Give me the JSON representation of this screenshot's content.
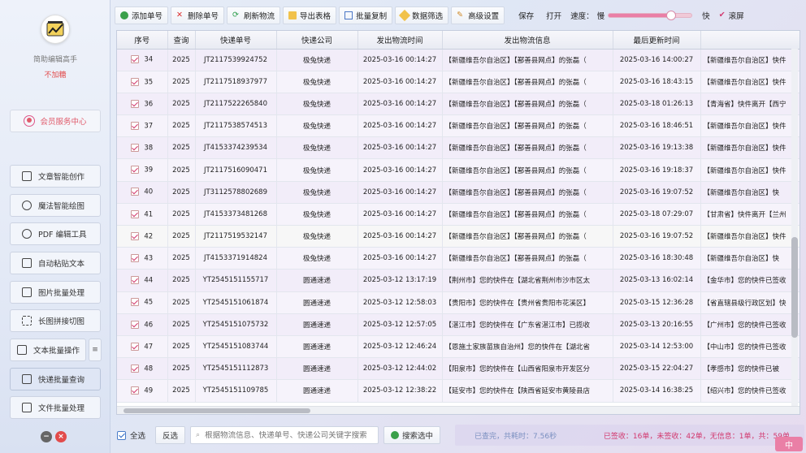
{
  "sidebar": {
    "app_title": "简助编辑高手",
    "app_sub": "不加糖",
    "member_center": "会员服务中心",
    "nav": [
      {
        "label": "文章智能创作",
        "icon": "article-icon"
      },
      {
        "label": "魔法智能绘图",
        "icon": "magic-wand-icon"
      },
      {
        "label": "PDF 编辑工具",
        "icon": "pdf-icon"
      },
      {
        "label": "自动粘贴文本",
        "icon": "paste-icon"
      },
      {
        "label": "图片批量处理",
        "icon": "image-icon"
      },
      {
        "label": "长图拼接切图",
        "icon": "crop-icon"
      },
      {
        "label": "文本批量操作",
        "icon": "text-icon"
      },
      {
        "label": "快递批量查询",
        "icon": "truck-icon"
      },
      {
        "label": "文件批量处理",
        "icon": "file-icon"
      }
    ]
  },
  "toolbar": {
    "add": "添加单号",
    "delete": "删除单号",
    "refresh": "刷新物流",
    "export": "导出表格",
    "copy": "批量复制",
    "filter": "数据筛选",
    "advanced": "高级设置",
    "save": "保存",
    "open": "打开",
    "speed_label": "速度：",
    "slow": "慢",
    "fast": "快",
    "scroll": "滚屏",
    "speed_value": 0.75
  },
  "table": {
    "headers": [
      "序号",
      "查询",
      "快递单号",
      "快递公司",
      "发出物流时间",
      "发出物流信息",
      "最后更新时间",
      ""
    ],
    "rows": [
      {
        "n": "34",
        "q": "2025",
        "no": "JT2117539924752",
        "co": "极兔快递",
        "t1": "2025-03-16 00:14:27",
        "info1": "【新疆维吾尔自治区】【鄯善县网点】的张磊（",
        "t2": "2025-03-16 14:00:27",
        "info2": "【新疆维吾尔自治区】快件"
      },
      {
        "n": "35",
        "q": "2025",
        "no": "JT2117518937977",
        "co": "极兔快递",
        "t1": "2025-03-16 00:14:27",
        "info1": "【新疆维吾尔自治区】【鄯善县网点】的张磊（",
        "t2": "2025-03-16 18:43:15",
        "info2": "【新疆维吾尔自治区】快件"
      },
      {
        "n": "36",
        "q": "2025",
        "no": "JT2117522265840",
        "co": "极兔快递",
        "t1": "2025-03-16 00:14:27",
        "info1": "【新疆维吾尔自治区】【鄯善县网点】的张磊（",
        "t2": "2025-03-18 01:26:13",
        "info2": "【青海省】快件离开【西宁"
      },
      {
        "n": "37",
        "q": "2025",
        "no": "JT2117538574513",
        "co": "极兔快递",
        "t1": "2025-03-16 00:14:27",
        "info1": "【新疆维吾尔自治区】【鄯善县网点】的张磊（",
        "t2": "2025-03-16 18:46:51",
        "info2": "【新疆维吾尔自治区】快件"
      },
      {
        "n": "38",
        "q": "2025",
        "no": "JT4153374239534",
        "co": "极兔快递",
        "t1": "2025-03-16 00:14:27",
        "info1": "【新疆维吾尔自治区】【鄯善县网点】的张磊（",
        "t2": "2025-03-16 19:13:38",
        "info2": "【新疆维吾尔自治区】快件"
      },
      {
        "n": "39",
        "q": "2025",
        "no": "JT2117516090471",
        "co": "极兔快递",
        "t1": "2025-03-16 00:14:27",
        "info1": "【新疆维吾尔自治区】【鄯善县网点】的张磊（",
        "t2": "2025-03-16 19:18:37",
        "info2": "【新疆维吾尔自治区】快件"
      },
      {
        "n": "40",
        "q": "2025",
        "no": "JT3112578802689",
        "co": "极兔快递",
        "t1": "2025-03-16 00:14:27",
        "info1": "【新疆维吾尔自治区】【鄯善县网点】的张磊（",
        "t2": "2025-03-16 19:07:52",
        "info2": "【新疆维吾尔自治区】快"
      },
      {
        "n": "41",
        "q": "2025",
        "no": "JT4153373481268",
        "co": "极兔快递",
        "t1": "2025-03-16 00:14:27",
        "info1": "【新疆维吾尔自治区】【鄯善县网点】的张磊（",
        "t2": "2025-03-18 07:29:07",
        "info2": "【甘肃省】快件离开【兰州"
      },
      {
        "n": "42",
        "q": "2025",
        "no": "JT2117519532147",
        "co": "极兔快递",
        "t1": "2025-03-16 00:14:27",
        "info1": "【新疆维吾尔自治区】【鄯善县网点】的张磊（",
        "t2": "2025-03-16 19:07:52",
        "info2": "【新疆维吾尔自治区】快件"
      },
      {
        "n": "43",
        "q": "2025",
        "no": "JT4153371914824",
        "co": "极兔快递",
        "t1": "2025-03-16 00:14:27",
        "info1": "【新疆维吾尔自治区】【鄯善县网点】的张磊（",
        "t2": "2025-03-16 18:30:48",
        "info2": "【新疆维吾尔自治区】快"
      },
      {
        "n": "44",
        "q": "2025",
        "no": "YT2545151155717",
        "co": "圆通速递",
        "t1": "2025-03-12 13:17:19",
        "info1": "【荆州市】您的快件在【湖北省荆州市沙市区太",
        "t2": "2025-03-13 16:02:14",
        "info2": "【金华市】您的快件已签收"
      },
      {
        "n": "45",
        "q": "2025",
        "no": "YT2545151061874",
        "co": "圆通速递",
        "t1": "2025-03-12 12:58:03",
        "info1": "【贵阳市】您的快件在【贵州省贵阳市花溪区】",
        "t2": "2025-03-15 12:36:28",
        "info2": "【省直辖县级行政区划】快"
      },
      {
        "n": "46",
        "q": "2025",
        "no": "YT2545151075732",
        "co": "圆通速递",
        "t1": "2025-03-12 12:57:05",
        "info1": "【湛江市】您的快件在【广东省湛江市】已揽收",
        "t2": "2025-03-13 20:16:55",
        "info2": "【广州市】您的快件已签收"
      },
      {
        "n": "47",
        "q": "2025",
        "no": "YT2545151083744",
        "co": "圆通速递",
        "t1": "2025-03-12 12:46:24",
        "info1": "【恩施土家族苗族自治州】您的快件在【湖北省",
        "t2": "2025-03-14 12:53:00",
        "info2": "【中山市】您的快件已签收"
      },
      {
        "n": "48",
        "q": "2025",
        "no": "YT2545151112873",
        "co": "圆通速递",
        "t1": "2025-03-12 12:44:02",
        "info1": "【阳泉市】您的快件在【山西省阳泉市开发区分",
        "t2": "2025-03-15 22:04:27",
        "info2": "【孝感市】您的快件已被"
      },
      {
        "n": "49",
        "q": "2025",
        "no": "YT2545151109785",
        "co": "圆通速递",
        "t1": "2025-03-12 12:38:22",
        "info1": "【延安市】您的快件在【陕西省延安市黄陵县店",
        "t2": "2025-03-14 16:38:25",
        "info2": "【绍兴市】您的快件已签收"
      }
    ]
  },
  "bottom": {
    "select_all": "全选",
    "invert": "反选",
    "search_placeholder": "根据物流信息、快递单号、快递公司关键字搜索",
    "search_selected": "搜索选中",
    "status_left": "已查完，共耗时：7.56秒",
    "status_right": "已签收：16单，未签收：42单，无信息：1单，共：59单",
    "ime": "中"
  }
}
